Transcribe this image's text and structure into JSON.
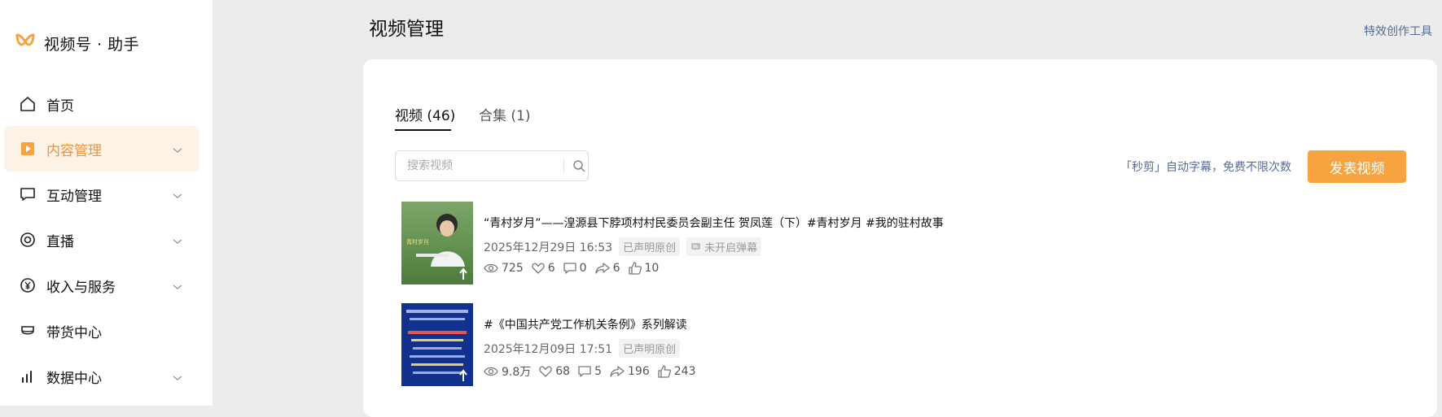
{
  "app": {
    "brand_name": "视频号 · 助手",
    "accent_color": "#f7a33f"
  },
  "sidebar": {
    "items": [
      {
        "label": "首页",
        "icon": "home-icon",
        "expandable": false,
        "active": false
      },
      {
        "label": "内容管理",
        "icon": "content-icon",
        "expandable": true,
        "active": true
      },
      {
        "label": "互动管理",
        "icon": "message-icon",
        "expandable": true,
        "active": false
      },
      {
        "label": "直播",
        "icon": "live-icon",
        "expandable": true,
        "active": false
      },
      {
        "label": "收入与服务",
        "icon": "yen-icon",
        "expandable": true,
        "active": false
      },
      {
        "label": "带货中心",
        "icon": "shop-icon",
        "expandable": false,
        "active": false
      },
      {
        "label": "数据中心",
        "icon": "chart-icon",
        "expandable": true,
        "active": false
      }
    ]
  },
  "header": {
    "title": "视频管理",
    "tool_link": "特效创作工具"
  },
  "tabs": [
    {
      "label": "视频 (46)",
      "active": true
    },
    {
      "label": "合集 (1)",
      "active": false
    }
  ],
  "search": {
    "placeholder": "搜索视频",
    "value": ""
  },
  "promo_text": "「秒剪」自动字幕，免费不限次数",
  "publish_button": "发表视频",
  "videos": [
    {
      "title": "“青村岁月”——湟源县下脖项村村民委员会副主任 贺凤莲（下）#青村岁月 #我的驻村故事",
      "datetime": "2025年12月29日 16:53",
      "tags": [
        "已声明原创",
        "未开启弹幕"
      ],
      "views": "725",
      "likes": "6",
      "comments": "0",
      "shares": "6",
      "thumbs": "10"
    },
    {
      "title": "#《中国共产党工作机关条例》系列解读",
      "datetime": "2025年12月09日 17:51",
      "tags": [
        "已声明原创"
      ],
      "views": "9.8万",
      "likes": "68",
      "comments": "5",
      "shares": "196",
      "thumbs": "243"
    }
  ]
}
